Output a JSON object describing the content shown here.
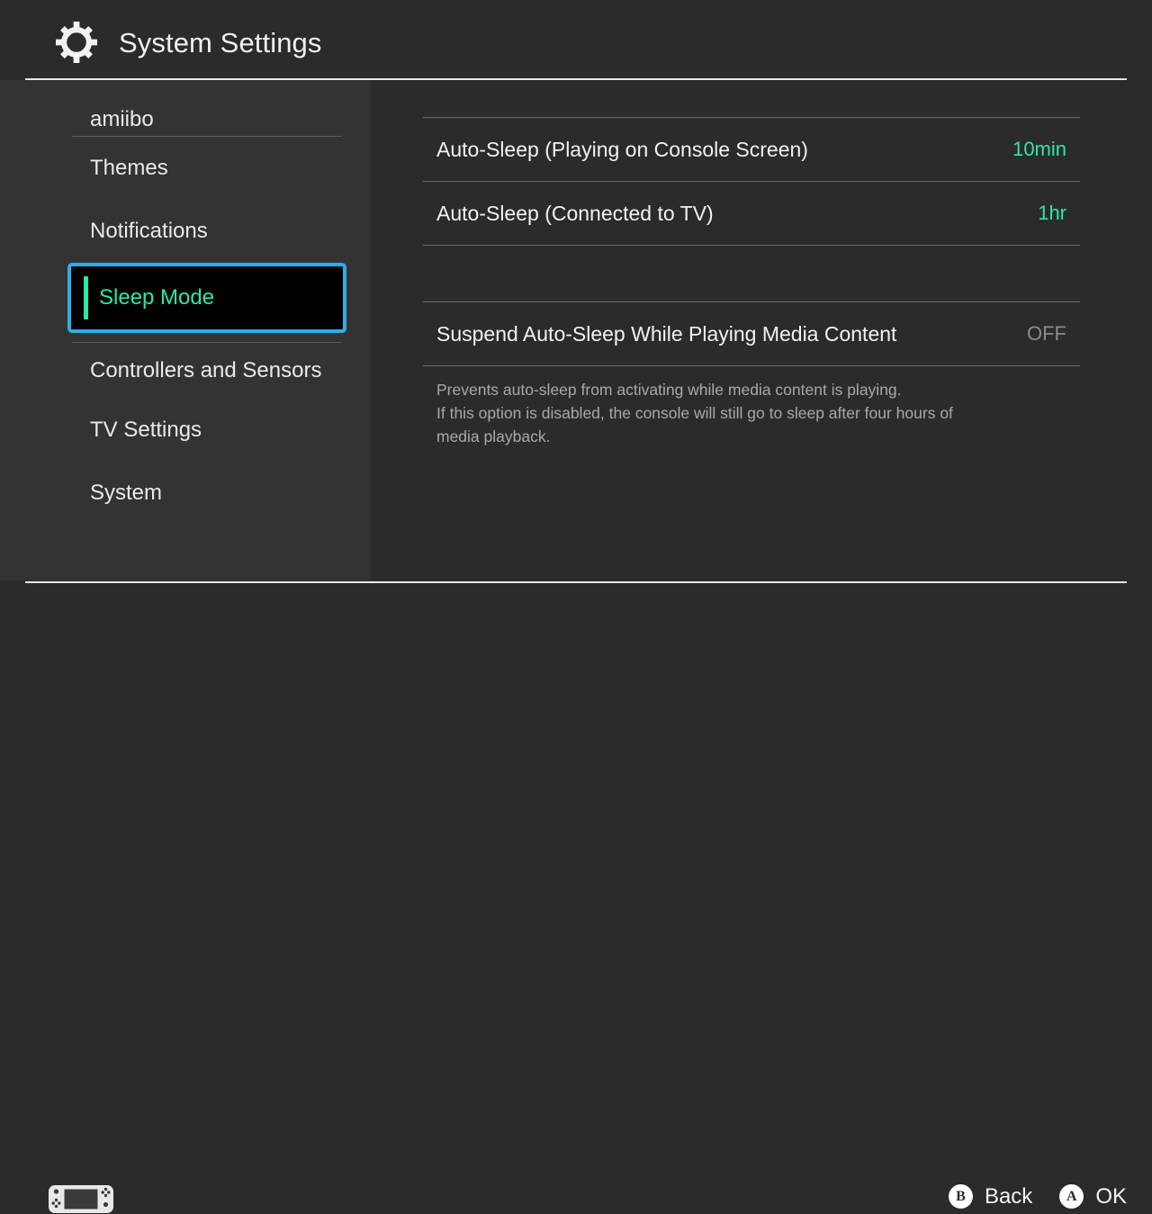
{
  "header": {
    "icon": "gear-icon",
    "title": "System Settings"
  },
  "sidebar": {
    "items": [
      {
        "label": "amiibo",
        "selected": false,
        "separator_after": true
      },
      {
        "label": "Themes",
        "selected": false,
        "separator_after": false
      },
      {
        "label": "Notifications",
        "selected": false,
        "separator_after": false
      },
      {
        "label": "Sleep Mode",
        "selected": true,
        "separator_after": true
      },
      {
        "label": "Controllers and Sensors",
        "selected": false,
        "separator_after": false
      },
      {
        "label": "TV Settings",
        "selected": false,
        "separator_after": false
      },
      {
        "label": "System",
        "selected": false,
        "separator_after": false
      }
    ]
  },
  "main": {
    "rows": [
      {
        "label": "Auto-Sleep (Playing on Console Screen)",
        "value": "10min",
        "value_style": "accent"
      },
      {
        "label": "Auto-Sleep (Connected to TV)",
        "value": "1hr",
        "value_style": "accent"
      },
      {
        "label": "",
        "value": "",
        "value_style": "blank"
      },
      {
        "label": "Suspend Auto-Sleep While Playing Media Content",
        "value": "OFF",
        "value_style": "muted"
      }
    ],
    "description": [
      "Prevents auto-sleep from activating while media content is playing.",
      "If this option is disabled, the console will still go to sleep after four hours of",
      "media playback."
    ]
  },
  "footer": {
    "console_icon": "switch-console-icon",
    "hints": [
      {
        "button": "B",
        "label": "Back"
      },
      {
        "button": "A",
        "label": "OK"
      }
    ]
  },
  "colors": {
    "accent_teal": "#2ae8a8",
    "selection_blue": "#2daee8",
    "sidebar_bg": "#333333",
    "main_bg": "#2b2b2b",
    "muted_text": "#8b8b8b"
  }
}
